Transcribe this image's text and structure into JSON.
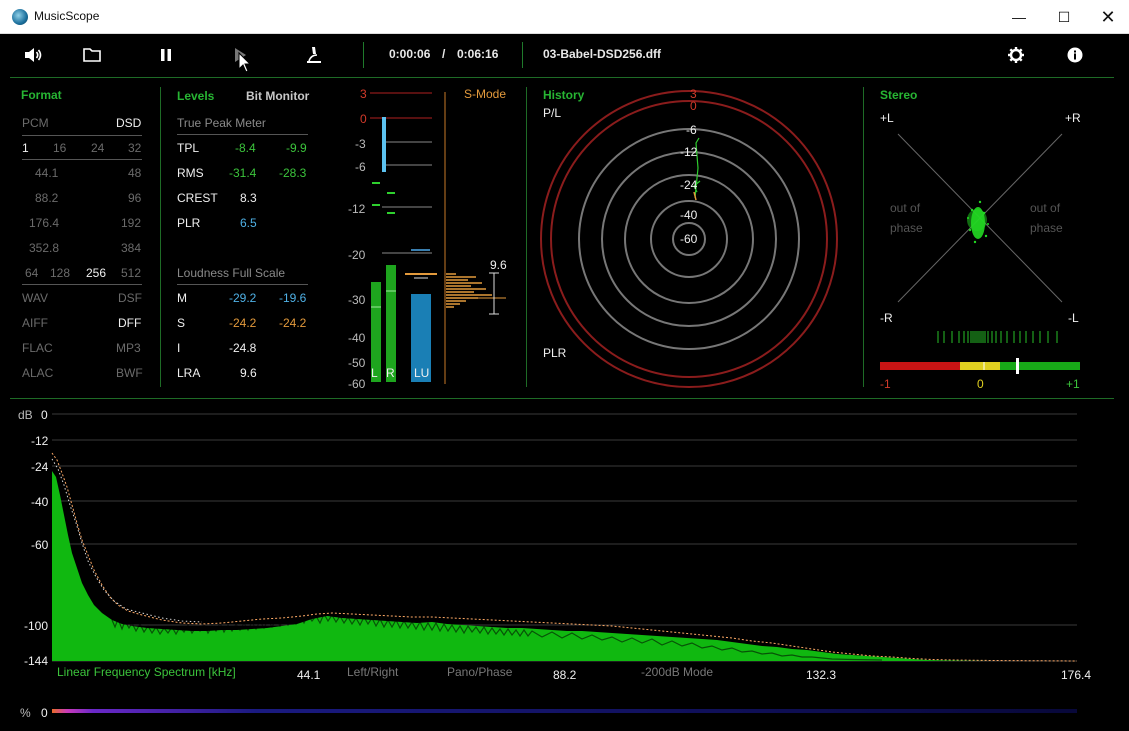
{
  "window": {
    "title": "MusicScope",
    "minimize": "—",
    "maximize": "☐",
    "close": "✕"
  },
  "toolbar": {
    "time_elapsed": "0:00:06",
    "time_sep": "/",
    "time_total": "0:06:16",
    "filename": "03-Babel-DSD256.dff",
    "icons": [
      "speaker-icon",
      "folder-icon",
      "pause-icon",
      "play-icon",
      "microscope-icon",
      "gear-icon",
      "info-icon"
    ]
  },
  "format": {
    "title": "Format",
    "pcm": "PCM",
    "dsd": "DSD",
    "rows": [
      [
        "1",
        "16",
        "24",
        "32"
      ],
      [
        "44.1",
        "48"
      ],
      [
        "88.2",
        "96"
      ],
      [
        "176.4",
        "192"
      ],
      [
        "352.8",
        "384"
      ],
      [
        "64",
        "128",
        "256",
        "512"
      ]
    ],
    "files": [
      [
        "WAV",
        "DSF"
      ],
      [
        "AIFF",
        "DFF"
      ],
      [
        "FLAC",
        "MP3"
      ],
      [
        "ALAC",
        "BWF"
      ]
    ]
  },
  "levels": {
    "title": "Levels",
    "bit_monitor": "Bit Monitor",
    "true_peak_title": "True Peak Meter",
    "tpl": {
      "label": "TPL",
      "left": "-8.4",
      "right": "-9.9"
    },
    "rms": {
      "label": "RMS",
      "left": "-31.4",
      "right": "-28.3"
    },
    "crest": {
      "label": "CREST",
      "value": "8.3"
    },
    "plr": {
      "label": "PLR",
      "value": "6.5"
    },
    "loudness_title": "Loudness Full Scale",
    "m": {
      "label": "M",
      "left": "-29.2",
      "right": "-19.6"
    },
    "s": {
      "label": "S",
      "left": "-24.2",
      "right": "-24.2"
    },
    "i": {
      "label": "I",
      "value": "-24.8"
    },
    "lra": {
      "label": "LRA",
      "value": "9.6"
    }
  },
  "meter": {
    "scale": [
      "3",
      "0",
      "-3",
      "-6",
      "-12",
      "-20",
      "-30",
      "-40",
      "-50",
      "-60"
    ],
    "l_label": "L",
    "r_label": "R",
    "lu_label": "LU",
    "s_mode": "S-Mode",
    "lra_value": "9.6"
  },
  "history": {
    "title": "History",
    "pl": "P/L",
    "plr": "PLR",
    "rings": [
      "3",
      "0",
      "-6",
      "-12",
      "-24",
      "-40",
      "-60"
    ]
  },
  "stereo": {
    "title": "Stereo",
    "plus_l": "+L",
    "plus_r": "+R",
    "minus_r": "-R",
    "minus_l": "-L",
    "out_of": "out of",
    "phase": "phase",
    "corr_min": "-1",
    "corr_mid": "0",
    "corr_max": "+1"
  },
  "spectrum": {
    "db_label": "dB",
    "y_ticks": [
      "0",
      "-12",
      "-24",
      "-40",
      "-60",
      "-100",
      "-144"
    ],
    "x_ticks": [
      "44.1",
      "88.2",
      "132.3",
      "176.4"
    ],
    "mode_title": "Linear Frequency Spectrum [kHz]",
    "modes": [
      "Left/Right",
      "Pano/Phase",
      "-200dB Mode"
    ],
    "pct_label": "%",
    "pct_value": "0"
  },
  "colors": {
    "accent_green": "#27b533",
    "level_blue": "#4fb1e6",
    "orange": "#e39a3c",
    "red": "#d23a2a"
  }
}
